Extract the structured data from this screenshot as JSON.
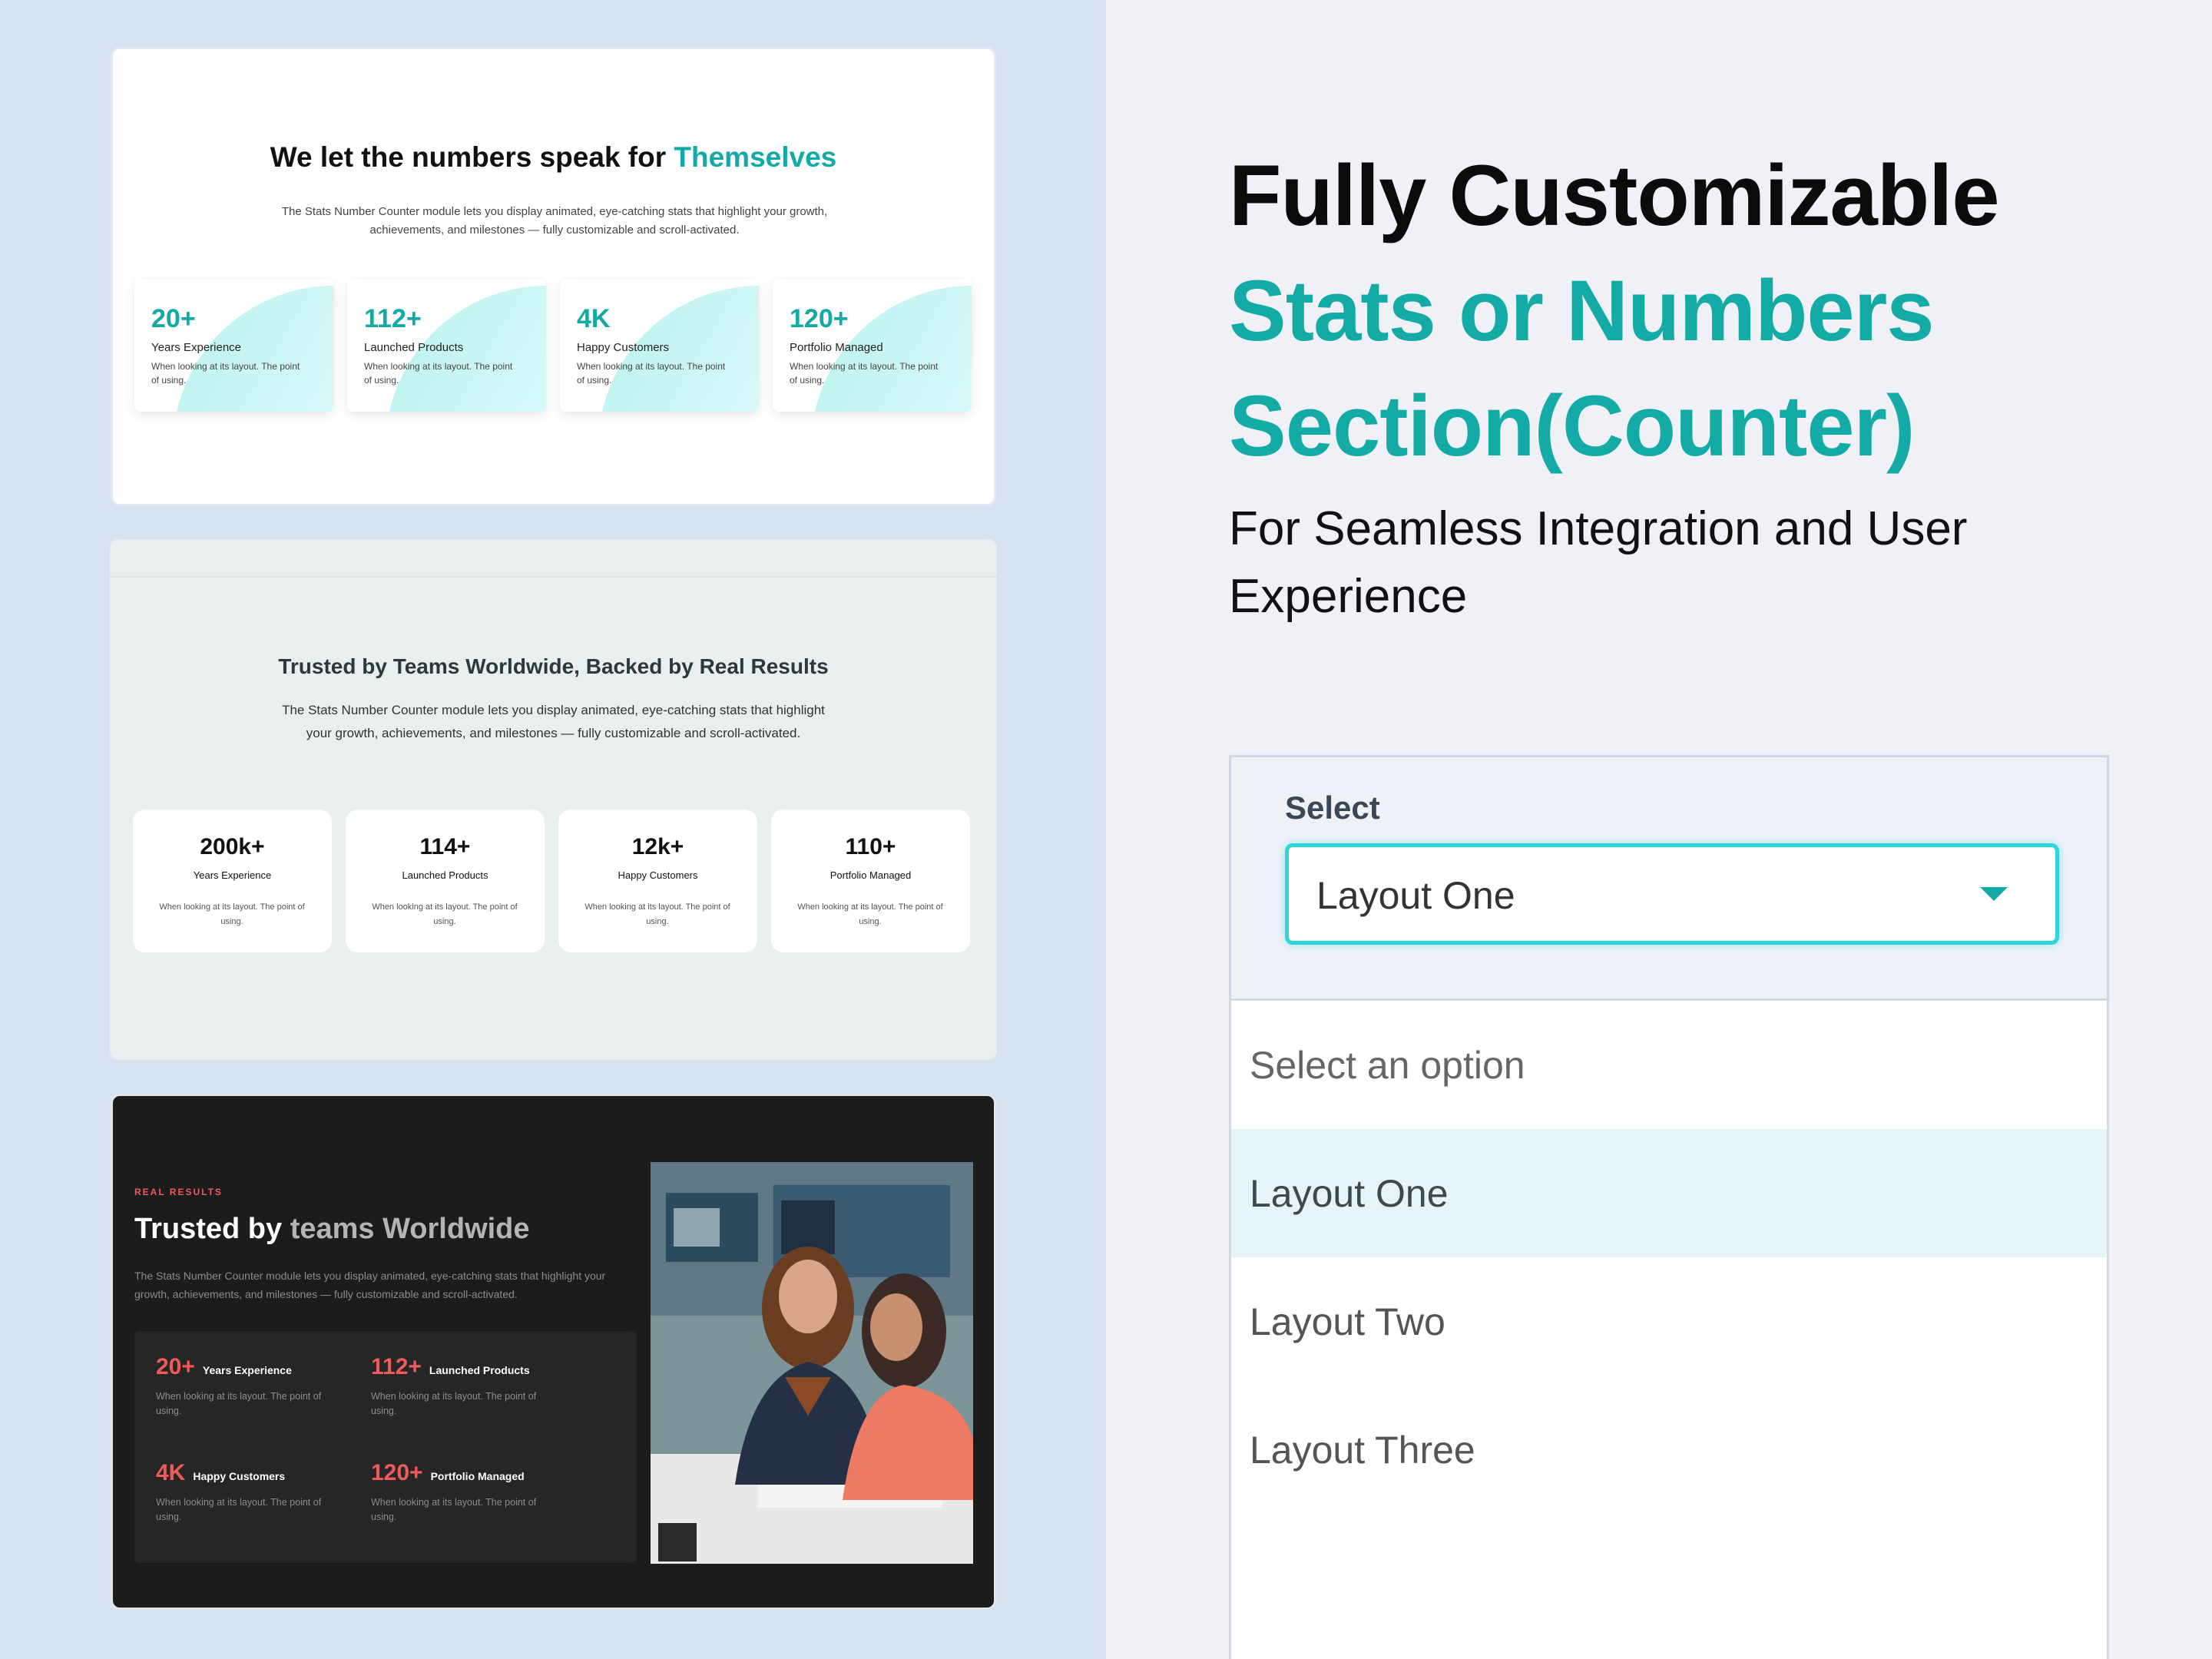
{
  "panel1": {
    "title_main": "We let the numbers speak for ",
    "title_accent": "Themselves",
    "description": "The Stats Number Counter module lets you display animated, eye-catching stats that highlight your growth, achievements, and milestones — fully customizable and scroll-activated.",
    "cards": [
      {
        "number": "20+",
        "label": "Years Experience",
        "text": "When looking at its layout. The point of using."
      },
      {
        "number": "112+",
        "label": "Launched Products",
        "text": "When looking at its layout. The point of using."
      },
      {
        "number": "4K",
        "label": "Happy Customers",
        "text": "When looking at its layout. The point of using."
      },
      {
        "number": "120+",
        "label": "Portfolio Managed",
        "text": "When looking at its layout. The point of using."
      }
    ]
  },
  "panel2": {
    "title": "Trusted by Teams Worldwide, Backed by Real Results",
    "description": "The Stats Number Counter module lets you display animated, eye-catching stats that highlight your growth, achievements, and milestones — fully customizable and scroll-activated.",
    "cards": [
      {
        "number": "200k+",
        "label": "Years Experience",
        "text": "When looking at its layout. The point of using."
      },
      {
        "number": "114+",
        "label": "Launched Products",
        "text": "When looking at its layout. The point of using."
      },
      {
        "number": "12k+",
        "label": "Happy Customers",
        "text": "When looking at its layout. The point of using."
      },
      {
        "number": "110+",
        "label": "Portfolio Managed",
        "text": "When looking at its layout. The point of using."
      }
    ]
  },
  "panel3": {
    "kicker": "REAL RESULTS",
    "title_main": "Trusted by ",
    "title_muted": "teams Worldwide",
    "description": "The Stats Number Counter module lets you display animated, eye-catching stats that highlight your growth, achievements, and milestones — fully customizable and scroll-activated.",
    "stats": [
      {
        "number": "20+",
        "label": "Years Experience",
        "text": "When looking at its layout. The point of using."
      },
      {
        "number": "112+",
        "label": "Launched Products",
        "text": "When looking at its layout. The point of using."
      },
      {
        "number": "4K",
        "label": "Happy Customers",
        "text": "When looking at its layout. The point of using."
      },
      {
        "number": "120+",
        "label": "Portfolio Managed",
        "text": "When looking at its layout. The point of using."
      }
    ]
  },
  "hero": {
    "line1": "Fully Customizable",
    "line2": "Stats or Numbers",
    "line3": "Section(Counter)",
    "subtitle": "For Seamless Integration and User Experience"
  },
  "select": {
    "label": "Select",
    "value": "Layout One",
    "options": [
      "Select an option",
      "Layout One",
      "Layout Two",
      "Layout Three"
    ]
  },
  "colors": {
    "accent_teal": "#13aaa6",
    "accent_red": "#ef5b5b",
    "focus_cyan": "#2fd5db"
  }
}
